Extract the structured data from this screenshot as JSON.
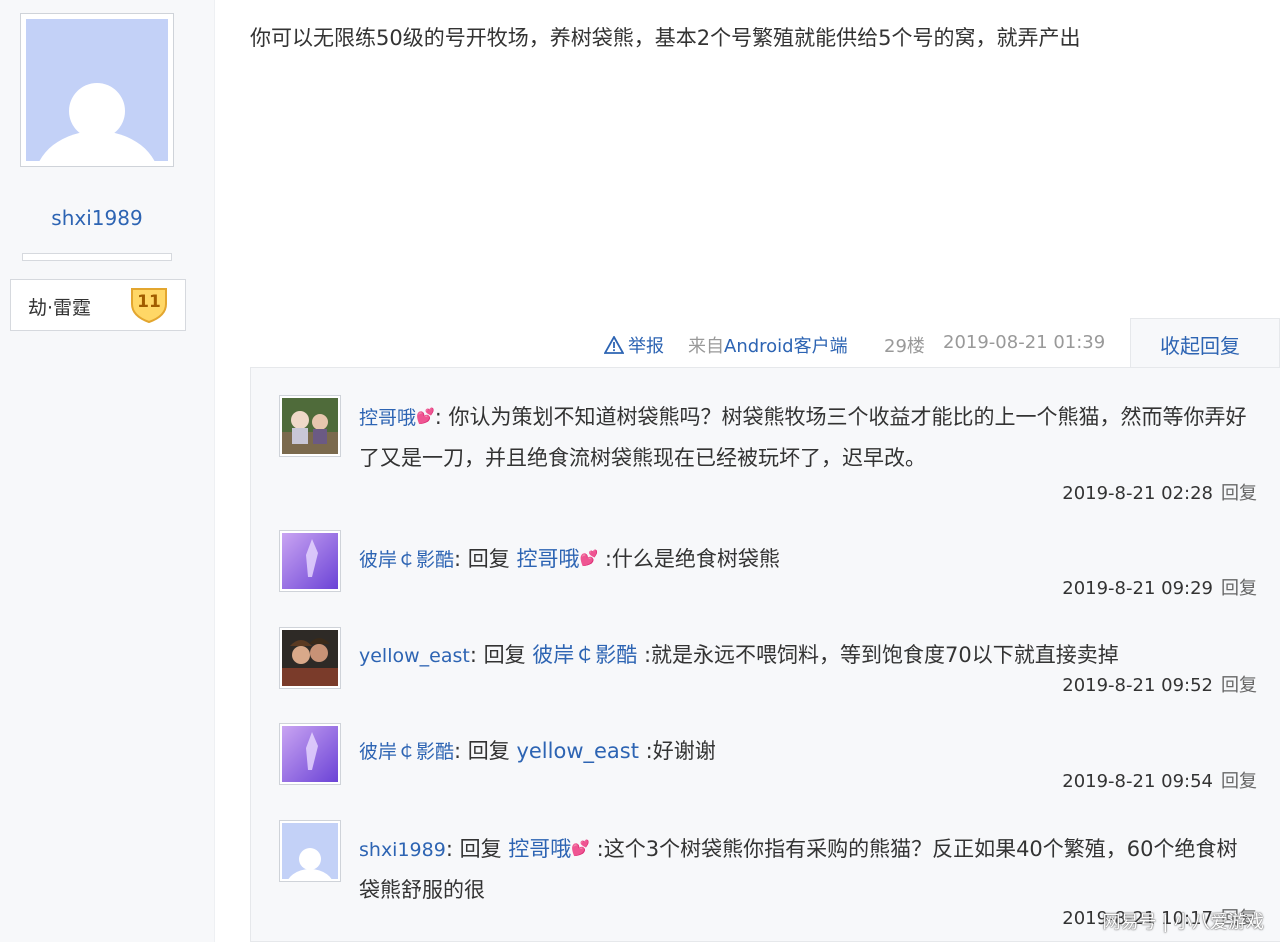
{
  "author": {
    "name": "shxi1989",
    "badge_label": "劫·雷霆",
    "badge_level": "11"
  },
  "post": {
    "content": "你可以无限练50级的号开牧场，养树袋熊，基本2个号繁殖就能供给5个号的窝，就弄产出"
  },
  "tail": {
    "report": "举报",
    "from_prefix": "来自",
    "client": "Android客户端",
    "floor": "29楼",
    "time": "2019-08-21 01:39",
    "collapse": "收起回复"
  },
  "replies": [
    {
      "user": "控哥哦",
      "emoji": "💕",
      "reply_word": "",
      "target": "",
      "target_emoji": "",
      "text": ": 你认为策划不知道树袋熊吗？树袋熊牧场三个收益才能比的上一个熊猫，然而等你弄好了又是一刀，并且绝食流树袋熊现在已经被玩坏了，迟早改。",
      "time": "2019-8-21 02:28",
      "reply_btn": "回复"
    },
    {
      "user": "彼岸￠影酷",
      "emoji": "",
      "reply_word": ": 回复 ",
      "target": "控哥哦",
      "target_emoji": "💕",
      "text": " :什么是绝食树袋熊",
      "time": "2019-8-21 09:29",
      "reply_btn": "回复"
    },
    {
      "user": "yellow_east",
      "emoji": "",
      "reply_word": ": 回复 ",
      "target": "彼岸￠影酷",
      "target_emoji": "",
      "text": " :就是永远不喂饲料，等到饱食度70以下就直接卖掉",
      "time": "2019-8-21 09:52",
      "reply_btn": "回复"
    },
    {
      "user": "彼岸￠影酷",
      "emoji": "",
      "reply_word": ": 回复 ",
      "target": "yellow_east",
      "target_emoji": "",
      "text": " :好谢谢",
      "time": "2019-8-21 09:54",
      "reply_btn": "回复"
    },
    {
      "user": "shxi1989",
      "emoji": "",
      "reply_word": ": 回复 ",
      "target": "控哥哦",
      "target_emoji": "💕",
      "text": " :这个3个树袋熊你指有采购的熊猫？反正如果40个繁殖，60个绝食树袋熊舒服的很",
      "time": "2019-8-21 10:17",
      "reply_btn": "回复"
    }
  ],
  "watermark": "网易号 | 小八爱游戏",
  "colors": {
    "link": "#2d64b3",
    "panel_bg": "#f7f8fa",
    "avatar_default": "#c3d1f7"
  }
}
